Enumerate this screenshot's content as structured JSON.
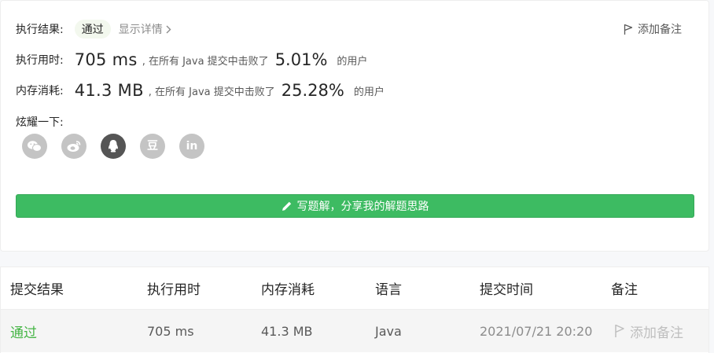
{
  "result": {
    "label": "执行结果:",
    "status": "通过",
    "details": "显示详情",
    "add_note": "添加备注"
  },
  "runtime": {
    "label": "执行用时:",
    "value": "705 ms",
    "text_before": ", 在所有 Java 提交中击败了",
    "percent": "5.01%",
    "text_after": "的用户"
  },
  "memory": {
    "label": "内存消耗:",
    "value": "41.3 MB",
    "text_before": ", 在所有 Java 提交中击败了",
    "percent": "25.28%",
    "text_after": "的用户"
  },
  "share": {
    "label": "炫耀一下:",
    "icons": [
      "wechat-icon",
      "weibo-icon",
      "qq-icon",
      "douban-icon",
      "linkedin-icon"
    ],
    "douban_glyph": "豆",
    "linkedin_glyph": "in"
  },
  "write_solution": "写题解，分享我的解题思路",
  "table": {
    "headers": [
      "提交结果",
      "执行用时",
      "内存消耗",
      "语言",
      "提交时间",
      "备注"
    ],
    "rows": [
      [
        "通过",
        "705 ms",
        "41.3 MB",
        "Java",
        "2021/07/21 20:20",
        "添加备注"
      ]
    ]
  },
  "colors": {
    "accent_green": "#3dbb62",
    "pass_green": "#45b545",
    "badge_bg": "#f3f8ee"
  }
}
